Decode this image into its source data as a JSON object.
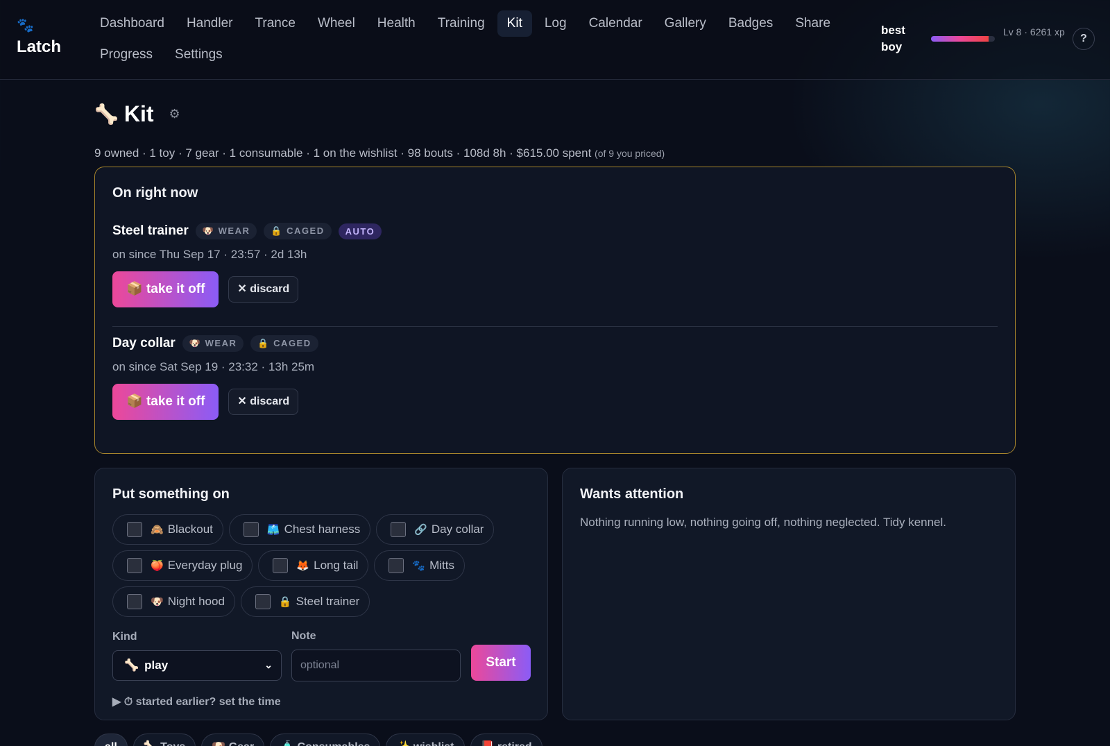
{
  "brand": {
    "paw_icon": "🐾",
    "name": "Latch"
  },
  "nav": {
    "row1": [
      "Dashboard",
      "Handler",
      "Trance",
      "Wheel",
      "Health",
      "Training",
      "Kit",
      "Log",
      "Calendar",
      "Gallery",
      "Badges",
      "Share"
    ],
    "row2": [
      "Progress",
      "Settings"
    ],
    "active": "Kit"
  },
  "user": {
    "name": "best boy",
    "level_text": "Lv 8 · 6261 xp",
    "xp_progress": 0.9,
    "help_label": "?"
  },
  "page": {
    "icon": "🦴",
    "title": "Kit",
    "gear_icon": "⚙",
    "summary": "9 owned · 1 toy · 7 gear · 1 consumable · 1 on the wishlist · 98 bouts · 108d 8h · $615.00 spent",
    "summary_note": "(of 9 you priced)"
  },
  "on_now": {
    "heading": "On right now",
    "items": [
      {
        "name": "Steel trainer",
        "tags": [
          {
            "icon": "🐶",
            "label": "WEAR"
          },
          {
            "icon": "🔒",
            "label": "CAGED"
          }
        ],
        "auto_label": "AUTO",
        "since": "on since Thu Sep 17 · 23:57 · 2d 13h",
        "take_off_label": "take it off",
        "take_off_icon": "📦",
        "discard_label": "discard",
        "discard_icon": "✕"
      },
      {
        "name": "Day collar",
        "tags": [
          {
            "icon": "🐶",
            "label": "WEAR"
          },
          {
            "icon": "🔒",
            "label": "CAGED"
          }
        ],
        "since": "on since Sat Sep 19 · 23:32 · 13h 25m",
        "take_off_label": "take it off",
        "take_off_icon": "📦",
        "discard_label": "discard",
        "discard_icon": "✕"
      }
    ]
  },
  "put_on": {
    "heading": "Put something on",
    "options": [
      {
        "icon": "🙈",
        "label": "Blackout"
      },
      {
        "icon": "🩳",
        "label": "Chest harness"
      },
      {
        "icon": "🔗",
        "label": "Day collar"
      },
      {
        "icon": "🍑",
        "label": "Everyday plug"
      },
      {
        "icon": "🦊",
        "label": "Long tail"
      },
      {
        "icon": "🐾",
        "label": "Mitts"
      },
      {
        "icon": "🐶",
        "label": "Night hood"
      },
      {
        "icon": "🔒",
        "label": "Steel trainer"
      }
    ],
    "kind_label": "Kind",
    "kind_value": "play",
    "kind_icon": "🦴",
    "note_label": "Note",
    "note_placeholder": "optional",
    "start_label": "Start",
    "earlier_label": "▶ ⏱ started earlier? set the time"
  },
  "wants_attention": {
    "heading": "Wants attention",
    "message": "Nothing running low, nothing going off, nothing neglected. Tidy kennel."
  },
  "filters": [
    "all",
    "🦴 Toys",
    "🐶 Gear",
    "🧴 Consumables",
    "✨ wishlist",
    "📕 retired"
  ]
}
